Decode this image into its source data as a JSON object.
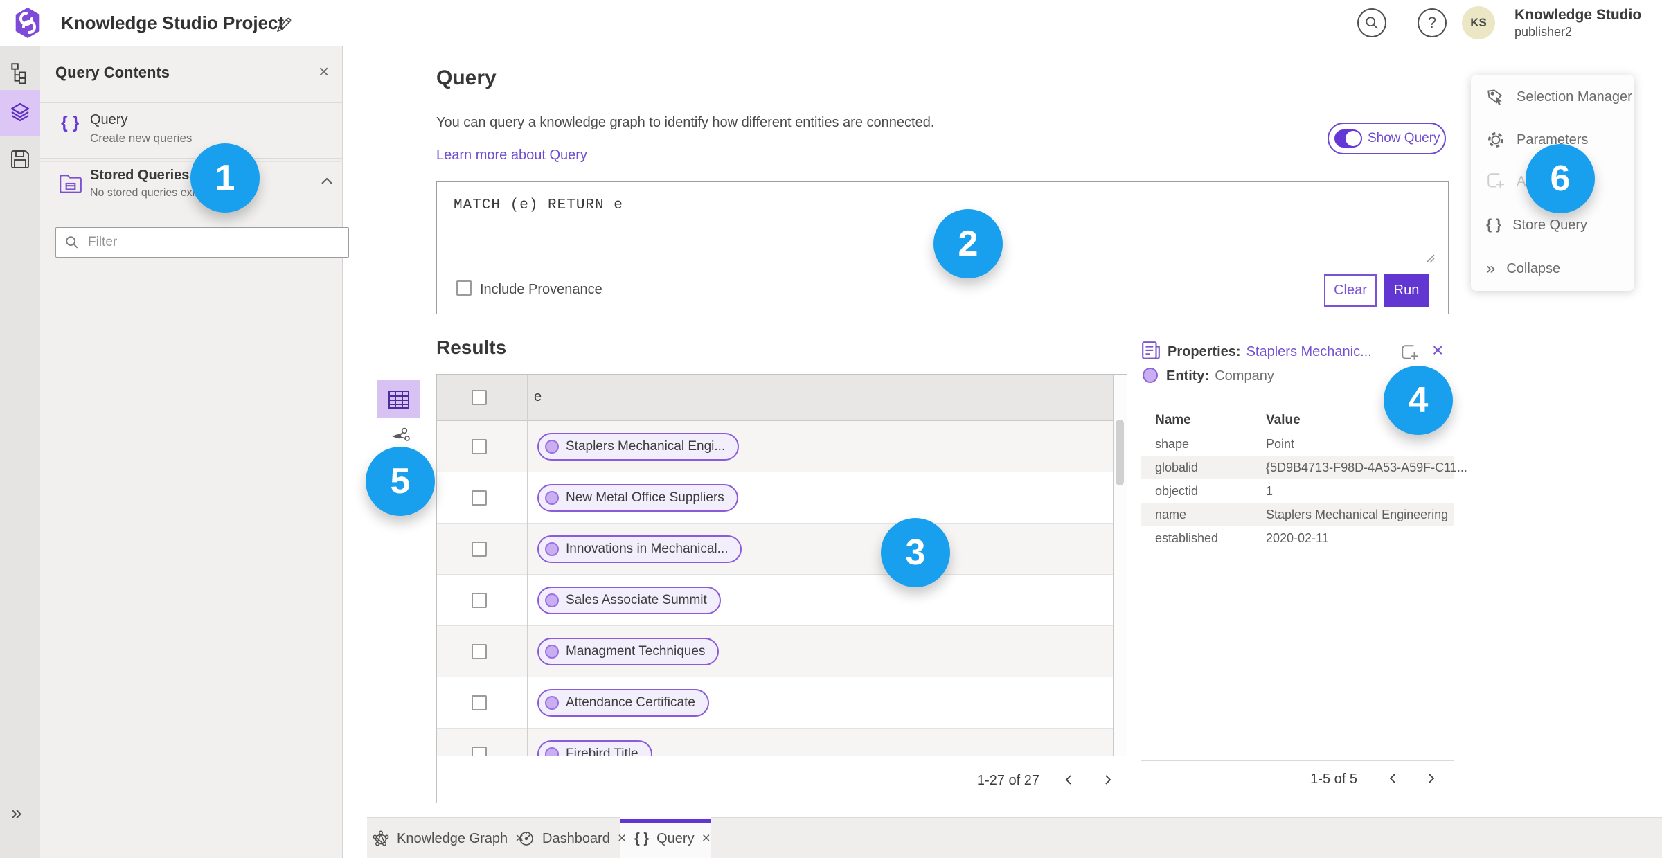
{
  "topbar": {
    "app_title": "Knowledge Studio Project",
    "user_name": "Knowledge Studio",
    "user_role": "publisher2",
    "avatar_initials": "KS",
    "help_glyph": "?"
  },
  "rail": {
    "expand_glyph": "»"
  },
  "contents_panel": {
    "title": "Query Contents",
    "close_glyph": "×",
    "query_item": {
      "icon_glyph": "{ }",
      "title": "Query",
      "subtitle": "Create new queries"
    },
    "stored_item": {
      "title": "Stored Queries",
      "subtitle": "No stored queries exist"
    },
    "filter_placeholder": "Filter"
  },
  "query_section": {
    "title": "Query",
    "description": "You can query a knowledge graph to identify how different entities are connected.",
    "learn_more": "Learn more about Query",
    "show_query": "Show Query",
    "query_text": "MATCH (e) RETURN e",
    "include_provenance": "Include Provenance",
    "clear": "Clear",
    "run": "Run"
  },
  "results": {
    "title": "Results",
    "column": "e",
    "rows": [
      {
        "label": "Staplers Mechanical Engi..."
      },
      {
        "label": "New Metal Office Suppliers"
      },
      {
        "label": "Innovations in Mechanical..."
      },
      {
        "label": "Sales Associate Summit"
      },
      {
        "label": "Managment Techniques"
      },
      {
        "label": "Attendance Certificate"
      },
      {
        "label": "Firebird Title"
      }
    ],
    "pagination": "1-27 of 27"
  },
  "properties": {
    "label": "Properties:",
    "entity_link": "Staplers Mechanic...",
    "close_glyph": "×",
    "entity_label": "Entity:",
    "entity_type": "Company",
    "name_header": "Name",
    "value_header": "Value",
    "rows": [
      {
        "name": "shape",
        "value": "Point"
      },
      {
        "name": "globalid",
        "value": "{5D9B4713-F98D-4A53-A59F-C11..."
      },
      {
        "name": "objectid",
        "value": "1"
      },
      {
        "name": "name",
        "value": "Staplers Mechanical Engineering"
      },
      {
        "name": "established",
        "value": "2020-02-11"
      }
    ],
    "pagination": "1-5 of 5"
  },
  "side_menu": {
    "selection_manager": "Selection Manager",
    "parameters": "Parameters",
    "add": "Add",
    "store_query": "Store Query",
    "store_query_glyph": "{ }",
    "collapse": "Collapse",
    "collapse_glyph": "»"
  },
  "bottom_tabs": [
    {
      "label": "Knowledge Graph"
    },
    {
      "label": "Dashboard"
    },
    {
      "label": "Query"
    }
  ],
  "tab_close_glyph": "×",
  "annotations": [
    {
      "number": "1"
    },
    {
      "number": "2"
    },
    {
      "number": "3"
    },
    {
      "number": "4"
    },
    {
      "number": "5"
    },
    {
      "number": "6"
    }
  ],
  "colors": {
    "accent_purple": "#6236d0",
    "link_purple": "#7452d4",
    "annotation_blue": "#18a0ee",
    "pill_fill": "#f3eefb",
    "rail_active": "#dcc6f6"
  }
}
